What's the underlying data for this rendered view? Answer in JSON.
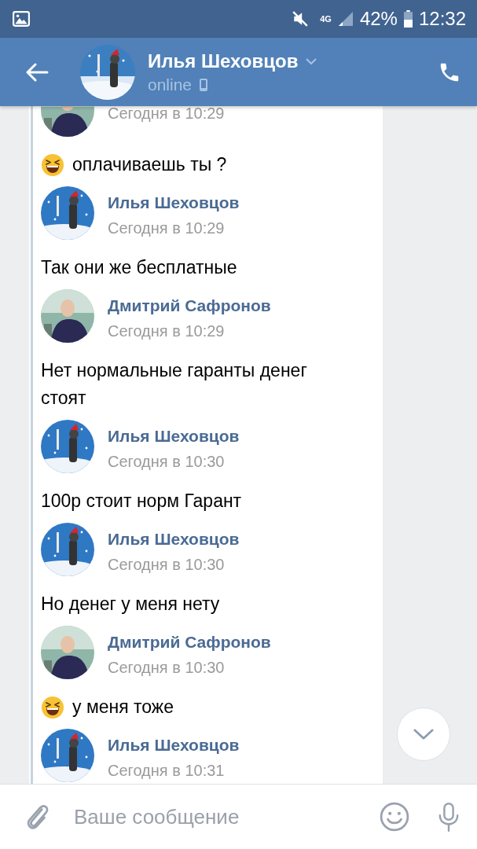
{
  "status_bar": {
    "battery": "42%",
    "time": "12:32",
    "network": "4G"
  },
  "header": {
    "name": "Илья Шеховцов",
    "status": "online"
  },
  "messages": [
    {
      "from_contact": false,
      "time": "Сегодня в 10:29",
      "emoji": true,
      "text": "оплачиваешь ты ?"
    },
    {
      "from_contact": true,
      "name": "Илья Шеховцов",
      "time": "Сегодня в 10:29",
      "emoji": false,
      "text": "Так они же бесплатные"
    },
    {
      "from_contact": false,
      "name": "Дмитрий Сафронов",
      "time": "Сегодня в 10:29",
      "emoji": false,
      "text": "Нет нормальные гаранты денег стоят"
    },
    {
      "from_contact": true,
      "name": "Илья Шеховцов",
      "time": "Сегодня в 10:30",
      "emoji": false,
      "text": "100р стоит норм Гарант"
    },
    {
      "from_contact": true,
      "name": "Илья Шеховцов",
      "time": "Сегодня в 10:30",
      "emoji": false,
      "text": "Но денег у меня нету"
    },
    {
      "from_contact": false,
      "name": "Дмитрий Сафронов",
      "time": "Сегодня в 10:30",
      "emoji": true,
      "text": "у меня тоже"
    },
    {
      "from_contact": true,
      "name": "Илья Шеховцов",
      "time": "Сегодня в 10:31"
    }
  ],
  "composer": {
    "placeholder": "Ваше сообщение"
  }
}
